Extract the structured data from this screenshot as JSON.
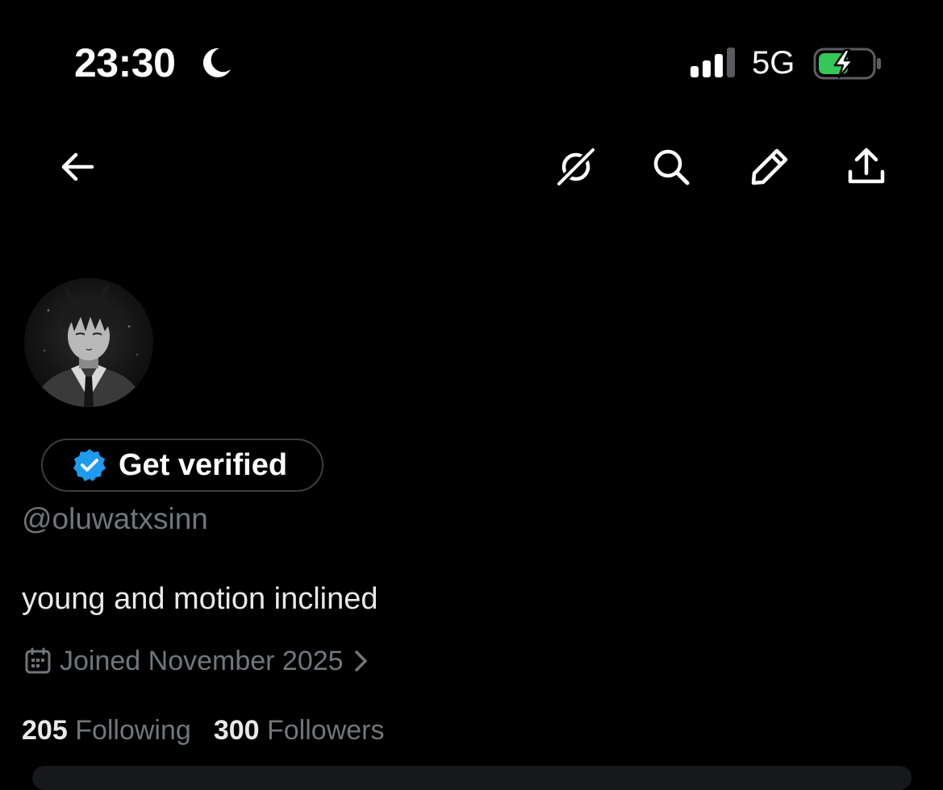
{
  "status_bar": {
    "time": "23:30",
    "network": "5G",
    "dnd_icon": "moon-icon",
    "signal_icon": "cellular-signal-icon",
    "battery_icon": "battery-charging-icon"
  },
  "nav": {
    "icons": [
      "back-arrow-icon",
      "grok-icon",
      "search-icon",
      "edit-pencil-icon",
      "share-icon"
    ]
  },
  "profile": {
    "verify_label": "Get verified",
    "handle": "@oluwatxsinn",
    "bio": "young and motion inclined",
    "joined": "Joined November 2025",
    "following_count": "205",
    "following_label": "Following",
    "followers_count": "300",
    "followers_label": "Followers"
  },
  "colors": {
    "background": "#000000",
    "verified_blue": "#1d9bf0",
    "battery_green": "#34c759",
    "muted_text": "#71767b"
  }
}
